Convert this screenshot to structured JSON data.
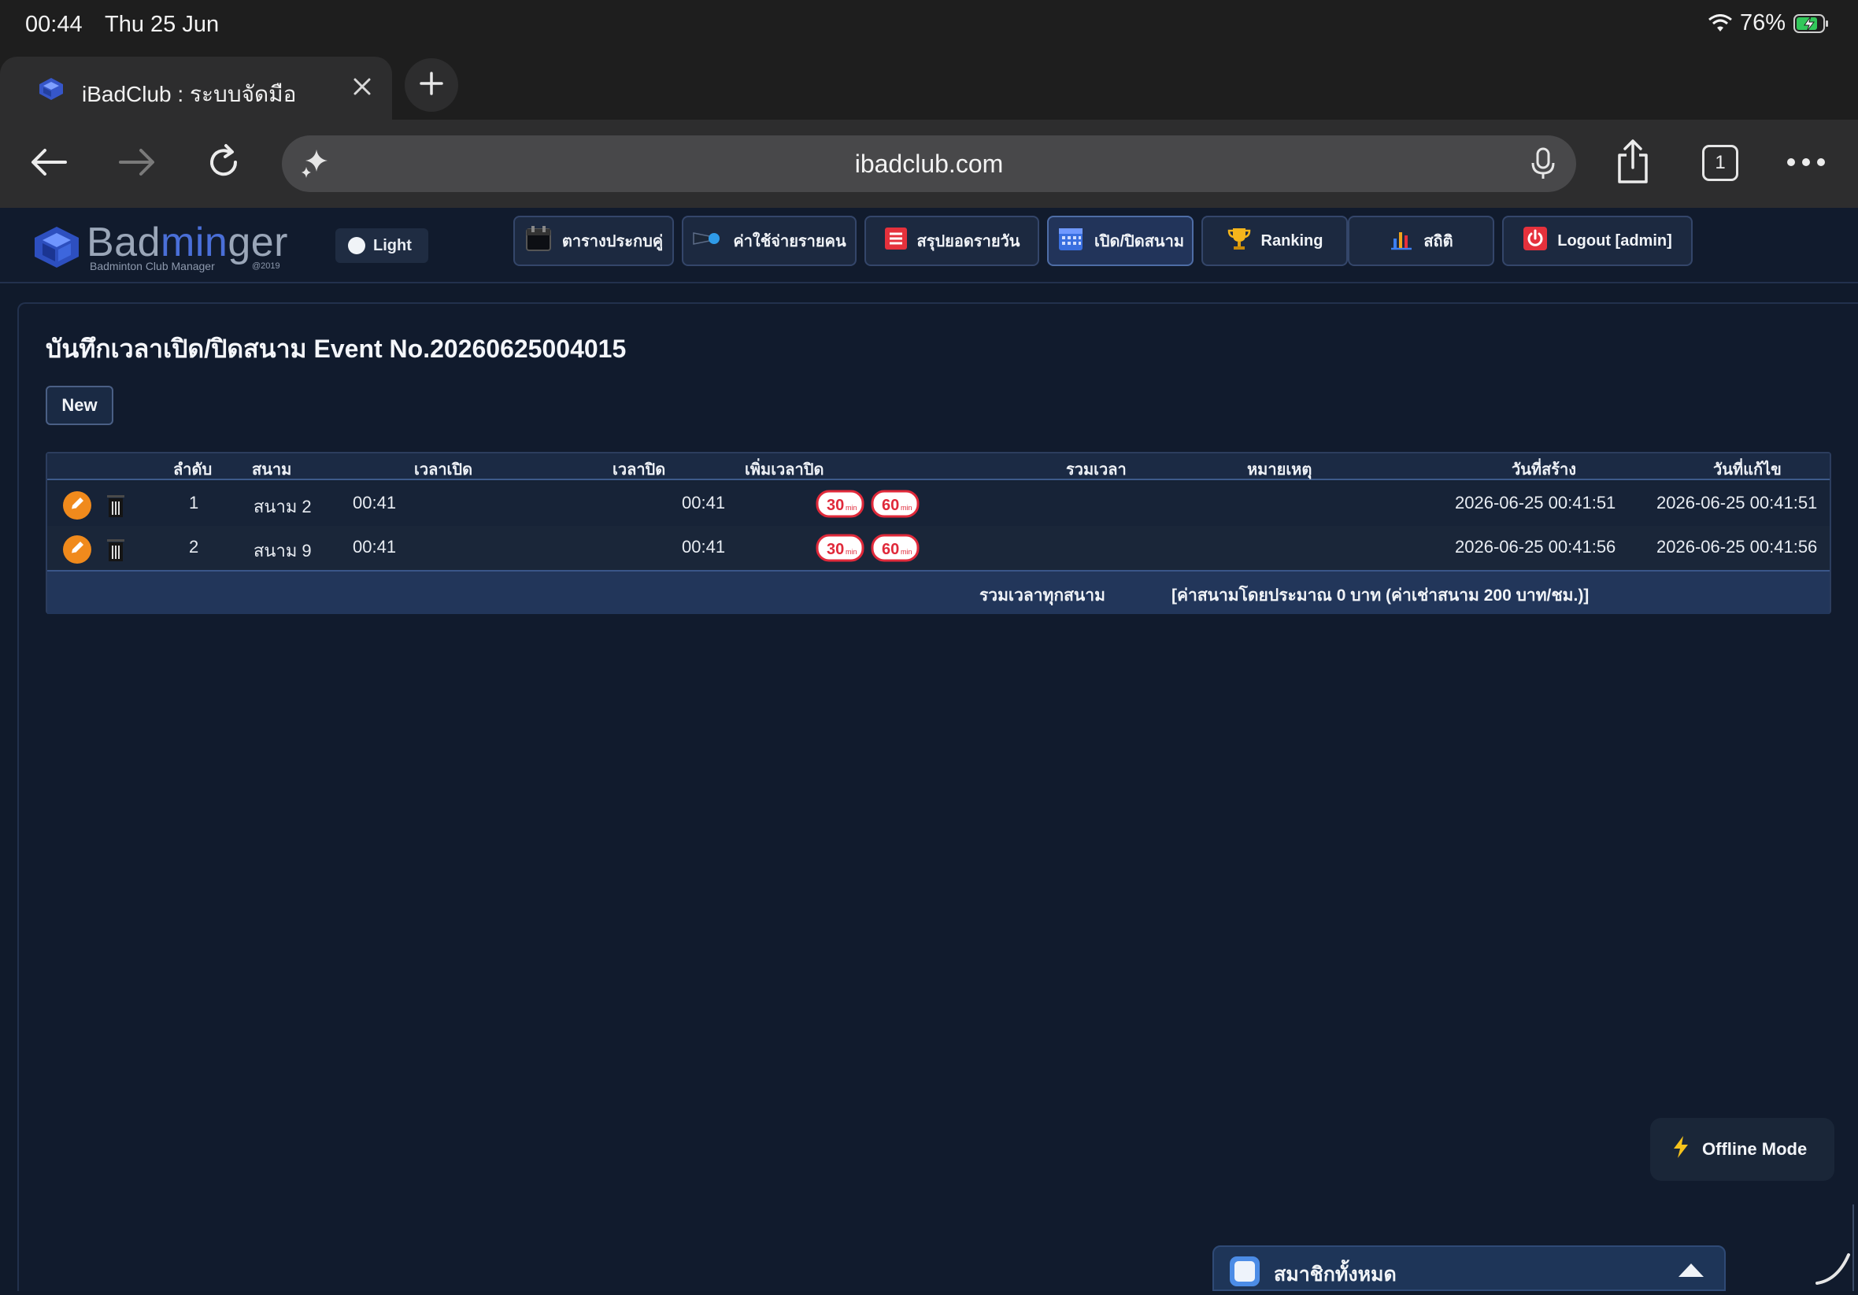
{
  "status_bar": {
    "time": "00:44",
    "date": "Thu 25 Jun",
    "battery": "76%",
    "icons": [
      "wifi-icon",
      "battery-charging-icon"
    ]
  },
  "browser": {
    "tab_title": "iBadClub : ระบบจัดมือ",
    "url": "ibadclub.com",
    "tab_count": "1",
    "icons": [
      "back-arrow-icon",
      "forward-arrow-icon",
      "reload-icon",
      "sparkle-icon",
      "mic-icon",
      "share-icon",
      "tabs-icon",
      "more-icon",
      "close-icon",
      "plus-icon"
    ]
  },
  "app_header": {
    "brand_part1": "Bad",
    "brand_part2": "min",
    "brand_part3": "ger",
    "brand_sub": "Badminton Club Manager",
    "brand_year": "@2019",
    "theme_label": "Light",
    "nav": [
      {
        "label": "ตารางประกบคู่",
        "icon": "calendar-icon"
      },
      {
        "label": "ค่าใช้จ่ายรายคน",
        "icon": "shuttlecock-icon"
      },
      {
        "label": "สรุปยอดรายวัน",
        "icon": "list-icon"
      },
      {
        "label": "เปิด/ปิดสนาม",
        "icon": "calendar-grid-icon",
        "active": true
      },
      {
        "label": "Ranking",
        "icon": "trophy-icon"
      },
      {
        "label": "สถิติ",
        "icon": "bar-chart-icon"
      },
      {
        "label": "Logout [admin]",
        "icon": "power-icon"
      }
    ]
  },
  "main": {
    "title": "บันทึกเวลาเปิด/ปิดสนาม Event No.20260625004015",
    "new_button": "New",
    "columns": {
      "seq": "ลำดับ",
      "court": "สนาม",
      "open_time": "เวลาเปิด",
      "close_time": "เวลาปิด",
      "add_time": "เพิ่มเวลาปิด",
      "total_time": "รวมเวลา",
      "note": "หมายเหตุ",
      "created": "วันที่สร้าง",
      "modified": "วันที่แก้ไข"
    },
    "rows": [
      {
        "seq": "1",
        "court": "สนาม 2",
        "open_time": "00:41",
        "close_time": "00:41",
        "total_time": "",
        "note": "",
        "created": "2026-06-25 00:41:51",
        "modified": "2026-06-25 00:41:51"
      },
      {
        "seq": "2",
        "court": "สนาม 9",
        "open_time": "00:41",
        "close_time": "00:41",
        "total_time": "",
        "note": "",
        "created": "2026-06-25 00:41:56",
        "modified": "2026-06-25 00:41:56"
      }
    ],
    "add_time_buttons": [
      {
        "num": "30",
        "unit": "min"
      },
      {
        "num": "60",
        "unit": "min"
      }
    ],
    "footer_total_label": "รวมเวลาทุกสนาม",
    "footer_cost": "[ค่าสนามโดยประมาณ 0 บาท (ค่าเช่าสนาม 200 บาท/ชม.)]"
  },
  "offline_button": "Offline Mode",
  "members_bar_label": "สมาชิกทั้งหมด",
  "colors": {
    "background": "#101a2b",
    "accent": "#4a6fd8",
    "edit_orange": "#f08a1c",
    "badge_red": "#e0293a"
  }
}
